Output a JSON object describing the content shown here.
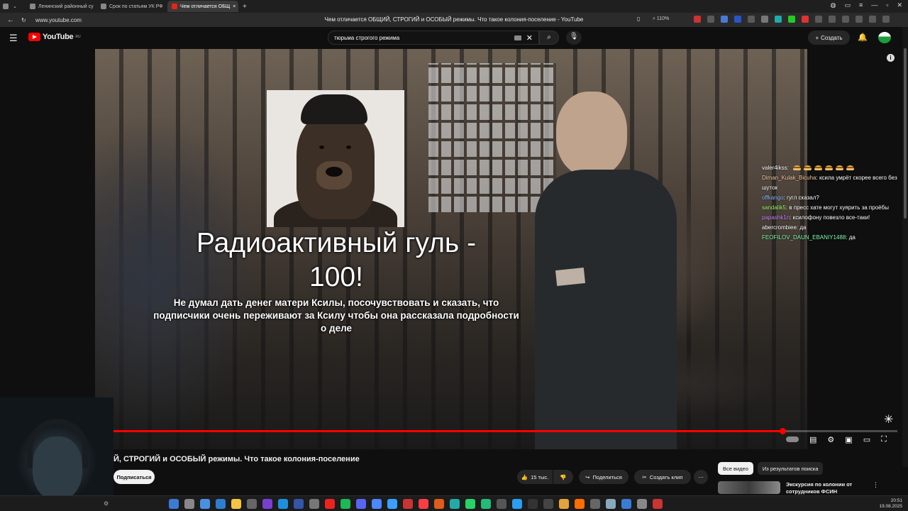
{
  "browser": {
    "tabs": [
      {
        "label": "Ленинский районный су"
      },
      {
        "label": "Срок по статьям УК РФ"
      },
      {
        "label": "Чем отличается ОБЩ"
      }
    ],
    "url": "www.youtube.com",
    "page_title": "Чем отличается ОБЩИЙ, СТРОГИЙ и ОСОБЫЙ режимы. Что такое колония-поселение - YouTube",
    "zoom": "110%"
  },
  "youtube": {
    "logo_text": "YouTube",
    "logo_region": "RU",
    "search_query": "тюрьма строгого режима",
    "create_label": "Создать"
  },
  "player": {
    "donation_title": "Радиоактивный гуль - 100!",
    "donation_message": "Не думал дать денег матери Ксилы, посочувствовать и сказать, что подписчики очень переживают за Ксилу чтобы она рассказала подробности о деле",
    "progress_fraction": 0.853
  },
  "chat": [
    {
      "user": "valer4ikss",
      "color": "#ffffff",
      "text": "",
      "emotes": 6
    },
    {
      "user": "Diman_Kulak_Bicuha",
      "color": "#f3c9a0",
      "text": "ксила умрёт скорее всего без шуток",
      "emotes": 0
    },
    {
      "user": "offkango",
      "color": "#8fb8ff",
      "text": "гугл сказал?",
      "emotes": 0
    },
    {
      "user": "sandalik5",
      "color": "#9dff6b",
      "text": "в пресс хате могут хуярить за проёбы",
      "emotes": 0
    },
    {
      "user": "papashk1n",
      "color": "#c58bff",
      "text": "ксилофону повезло все-таки!",
      "emotes": 0
    },
    {
      "user": "abercrombiee",
      "color": "#ffffff",
      "text": "да",
      "emotes": 0
    },
    {
      "user": "FEOFILOV_DAUN_EBANIY1488",
      "color": "#7dffb0",
      "text": "да",
      "emotes": 0
    }
  ],
  "video": {
    "title": "Й, СТРОГИЙ и ОСОБЫЙ режимы. Что такое колония-поселение",
    "subscribe_label": "Подписаться",
    "likes": "15 тыс.",
    "share_label": "Поделиться",
    "clip_label": "Создать клип"
  },
  "sidebar": {
    "chips": [
      {
        "label": "Все видео"
      },
      {
        "label": "Из результатов поиска"
      }
    ],
    "recommendation_title": "Экскурсия по колонии от сотрудников ФСИН"
  },
  "taskbar": {
    "time": "20:51",
    "date": "19.08.2025"
  },
  "colors": {
    "accent": "#ff0000",
    "background": "#0f0f0f"
  }
}
